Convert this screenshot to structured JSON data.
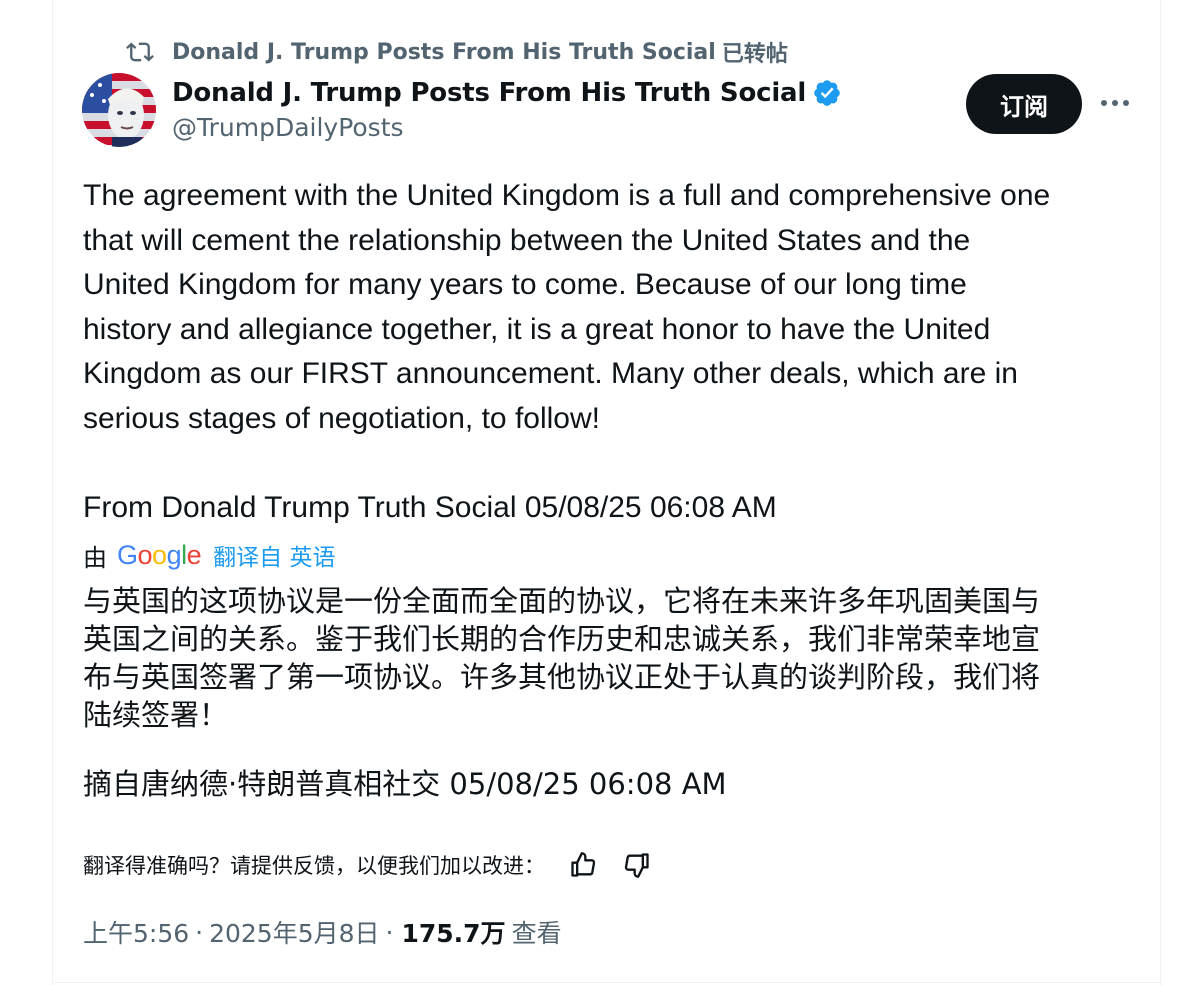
{
  "repost": {
    "text": "Donald J. Trump Posts From His Truth Social",
    "suffix": "已转帖",
    "icon": "repost-icon"
  },
  "author": {
    "display_name": "Donald J. Trump Posts From His Truth Social",
    "handle": "@TrumpDailyPosts",
    "verified": true,
    "avatar": "avatar"
  },
  "actions": {
    "subscribe_label": "订阅",
    "more_icon": "more-icon"
  },
  "post": {
    "body_lines": [
      "The agreement with the United Kingdom is a full and comprehensive one",
      "that will cement the relationship between the United States and the",
      "United Kingdom for many years to come. Because of our long time",
      "history and allegiance together, it is a great honor to have the United",
      "Kingdom as our FIRST announcement. Many other deals, which are in",
      "serious stages of negotiation, to follow!"
    ],
    "source_line": "From Donald Trump Truth Social 05/08/25 06:08 AM"
  },
  "translation": {
    "by_label": "由",
    "provider": "Google",
    "link_text": "翻译自 英语",
    "lines": [
      "与英国的这项协议是一份全面而全面的协议，它将在未来许多年巩固美国与",
      "英国之间的关系。鉴于我们长期的合作历史和忠诚关系，我们非常荣幸地宣",
      "布与英国签署了第一项协议。许多其他协议正处于认真的谈判阶段，我们将",
      "陆续签署！"
    ],
    "source_line": "摘自唐纳德·特朗普真相社交 05/08/25 06:08 AM",
    "feedback_prompt": "翻译得准确吗？请提供反馈，以便我们加以改进：",
    "thumbs_up_icon": "thumbs-up-icon",
    "thumbs_down_icon": "thumbs-down-icon"
  },
  "meta": {
    "time": "上午5:56",
    "separator": "·",
    "date": "2025年5月8日",
    "views": "175.7万",
    "views_label": "查看"
  },
  "colors": {
    "text": "#0f1419",
    "secondary": "#536471",
    "link": "#1d9bf0",
    "verified": "#1d9bf0",
    "button_bg": "#0f1419"
  }
}
